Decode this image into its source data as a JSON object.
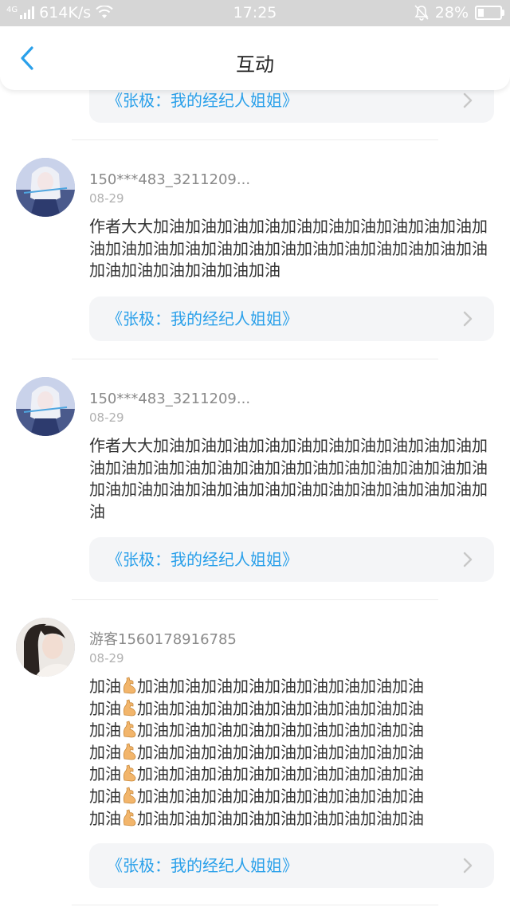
{
  "status_bar": {
    "network_type": "4G",
    "speed": "614K/s",
    "time": "17:25",
    "battery": "28%",
    "battery_fraction": 0.28
  },
  "header": {
    "title": "互动",
    "back_icon": "chevron-left-icon",
    "accent_color": "#2aa0ea"
  },
  "top_book_link": {
    "title": "《张极：我的经纪人姐姐》"
  },
  "comments": [
    {
      "username": "150***483_3211209...",
      "date": "08-29",
      "text": "作者大大加油加油加油加油加油加油加油加油加油加油加油加油加油加油加油加油加油加油加油加油加油加油加油加油加油加油加油加油加油",
      "book_title": "《张极：我的经纪人姐姐》"
    },
    {
      "username": "150***483_3211209...",
      "date": "08-29",
      "text": "作者大大加油加油加油加油加油加油加油加油加油加油加油加油加油加油加油加油加油加油加油加油加油加油加油加油加油加油加油加油加油加油加油加油加油加油加油加油",
      "book_title": "《张极：我的经纪人姐姐》"
    },
    {
      "username": "游客1560178916785",
      "date": "08-29",
      "lines": [
        {
          "before": "加油",
          "after": "加油加油加油加油加油加油加油加油加油"
        },
        {
          "before": "加油",
          "after": "加油加油加油加油加油加油加油加油加油"
        },
        {
          "before": "加油",
          "after": "加油加油加油加油加油加油加油加油加油"
        },
        {
          "before": "加油",
          "after": "加油加油加油加油加油加油加油加油加油"
        },
        {
          "before": "加油",
          "after": "加油加油加油加油加油加油加油加油加油"
        },
        {
          "before": "加油",
          "after": "加油加油加油加油加油加油加油加油加油"
        },
        {
          "before": "加油",
          "after": "加油加油加油加油加油加油加油加油加油"
        }
      ],
      "emoji_icon": "flexed-biceps-icon",
      "book_title": "《张极：我的经纪人姐姐》"
    }
  ]
}
